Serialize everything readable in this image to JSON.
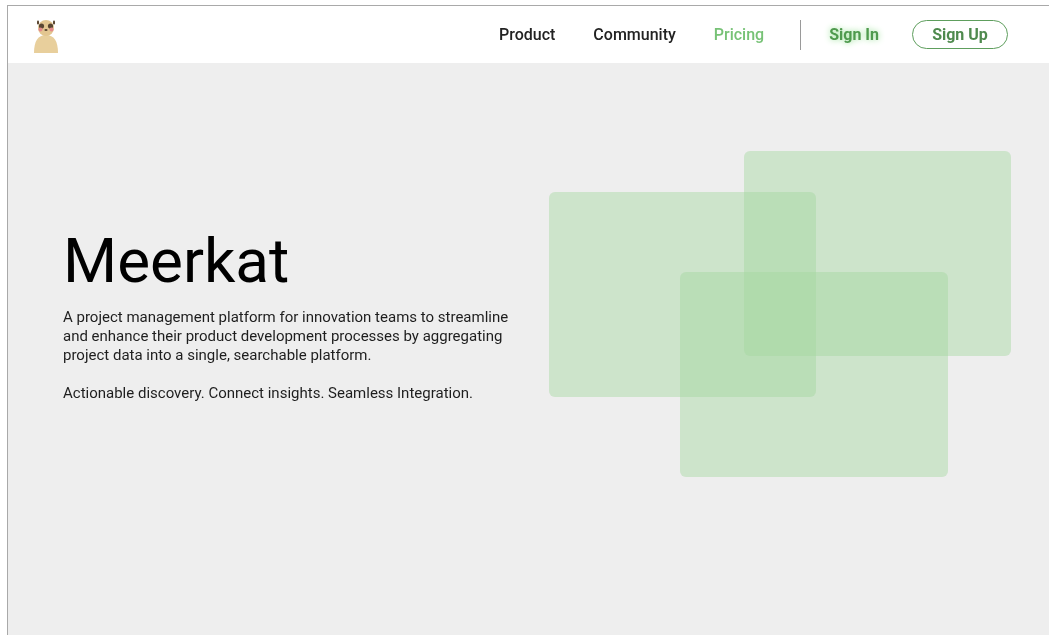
{
  "nav": {
    "links": [
      {
        "label": "Product",
        "selected": false
      },
      {
        "label": "Community",
        "selected": false
      },
      {
        "label": "Pricing",
        "selected": true
      }
    ],
    "sign_in": "Sign In",
    "sign_up": "Sign Up"
  },
  "hero": {
    "title": "Meerkat",
    "description": "A project management platform for innovation teams to streamline and enhance their product development processes by aggregating project data into a single, searchable platform.",
    "tagline": "Actionable discovery. Connect insights. Seamless Integration."
  }
}
